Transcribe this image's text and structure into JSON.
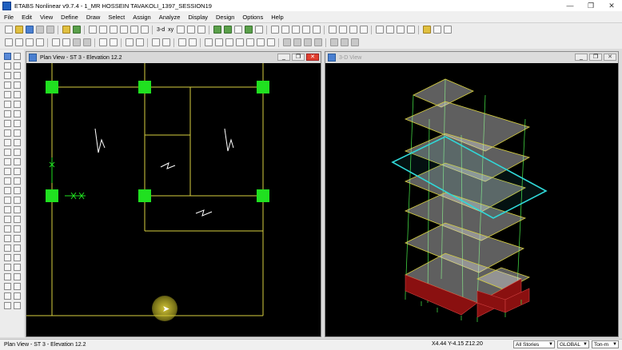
{
  "window": {
    "title": "ETABS Nonlinear v9.7.4 - 1_MR HOSSEIN TAVAKOLI_1397_SESSION19",
    "minimize": "—",
    "maximize": "❐",
    "close": "✕"
  },
  "menu": [
    "File",
    "Edit",
    "View",
    "Define",
    "Draw",
    "Select",
    "Assign",
    "Analyze",
    "Display",
    "Design",
    "Options",
    "Help"
  ],
  "toolbar": {
    "threed_label": "3-d",
    "text_label": "xy"
  },
  "plan_view": {
    "title": "Plan View - ST 3 - Elevation 12.2",
    "background": "#000000",
    "grid_color": "#d8d040",
    "column_color": "#20e020"
  },
  "view3d": {
    "title": "3-D View",
    "highlight_color": "#30d8d8"
  },
  "status": {
    "left_text": "Plan View - ST 3 - Elevation 12.2",
    "coords": "X4.44  Y-4.15  Z12.20",
    "stories_value": "All Stories",
    "coord_system": "GLOBAL",
    "units": "Ton-m"
  },
  "icons": [
    "app-icon",
    "new-icon",
    "open-icon",
    "save-icon",
    "undo-icon",
    "redo-icon",
    "lock-icon",
    "run-icon",
    "zoom-icon",
    "pan-icon",
    "refresh-icon",
    "select-icon",
    "pointer-icon"
  ]
}
